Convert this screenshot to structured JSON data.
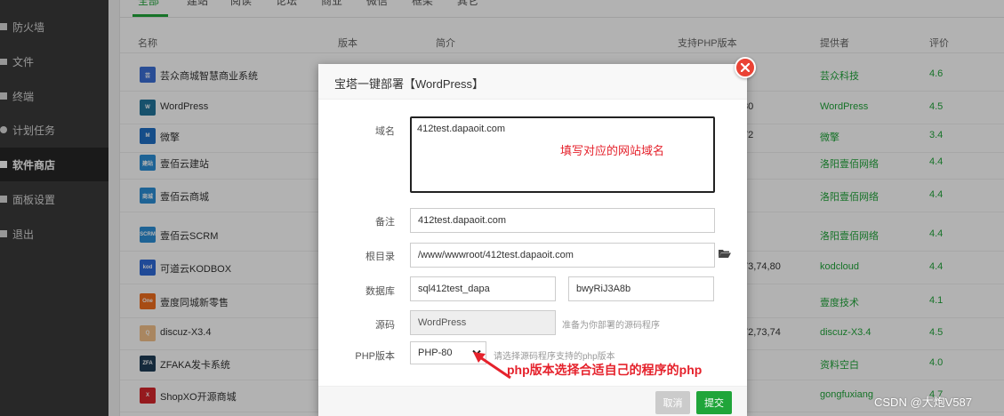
{
  "sidebar": {
    "items": [
      {
        "label": "防火墙",
        "icon": "shield-icon"
      },
      {
        "label": "文件",
        "icon": "folder-icon"
      },
      {
        "label": "终端",
        "icon": "terminal-icon"
      },
      {
        "label": "计划任务",
        "icon": "clock-icon"
      },
      {
        "label": "软件商店",
        "icon": "store-icon"
      },
      {
        "label": "面板设置",
        "icon": "gear-icon"
      },
      {
        "label": "退出",
        "icon": "logout-icon"
      }
    ],
    "active_index": 4
  },
  "tabs": [
    "全部",
    "建站",
    "阅读",
    "论坛",
    "商业",
    "微信",
    "框架",
    "其它"
  ],
  "table": {
    "headers": {
      "name": "名称",
      "version": "版本",
      "intro": "简介",
      "php": "支持PHP版本",
      "provider": "提供者",
      "score": "评价"
    },
    "rows": [
      {
        "name": "芸众商城智慧商业系统",
        "version": "",
        "provider": "芸众科技",
        "score": "4.6",
        "logo_color": "#3b6fd6",
        "logo_text": "芸"
      },
      {
        "name": "WordPress",
        "version": "80",
        "provider": "WordPress",
        "score": "4.5",
        "logo_color": "#21759b",
        "logo_text": "W"
      },
      {
        "name": "微擎",
        "version": "72",
        "provider": "微擎",
        "score": "3.4",
        "logo_color": "#1f6fc5",
        "logo_text": "M"
      },
      {
        "name": "壹佰云建站",
        "version": "",
        "provider": "洛阳壹佰网络",
        "score": "4.4",
        "logo_color": "#2c8fd6",
        "logo_text": "建站"
      },
      {
        "name": "壹佰云商城",
        "version": "",
        "provider": "洛阳壹佰网络",
        "score": "4.4",
        "logo_color": "#2c8fd6",
        "logo_text": "商城"
      },
      {
        "name": "壹佰云SCRM",
        "version": "",
        "provider": "洛阳壹佰网络",
        "score": "4.4",
        "logo_color": "#2c8fd6",
        "logo_text": "SCRM"
      },
      {
        "name": "可道云KODBOX",
        "version": "73,74,80",
        "provider": "kodcloud",
        "score": "4.4",
        "logo_color": "#2f6bd8",
        "logo_text": "kod"
      },
      {
        "name": "壹度同城新零售",
        "version": "",
        "provider": "壹度技术",
        "score": "4.1",
        "logo_color": "#f06d1d",
        "logo_text": "One"
      },
      {
        "name": "discuz-X3.4",
        "version": "72,73,74",
        "provider": "discuz-X3.4",
        "score": "4.5",
        "logo_color": "#f3c08a",
        "logo_text": "Q"
      },
      {
        "name": "ZFAKA发卡系统",
        "version": "",
        "provider": "资料空白",
        "score": "4.0",
        "logo_color": "#1f3d57",
        "logo_text": "ZFA"
      },
      {
        "name": "ShopXO开源商城",
        "version": "",
        "provider": "gongfuxiang",
        "score": "4.7",
        "logo_color": "#d6262c",
        "logo_text": "X"
      }
    ]
  },
  "modal": {
    "title": "宝塔一键部署【WordPress】",
    "domain_label": "域名",
    "domain_value": "412test.dapaoit.com",
    "note_label": "备注",
    "note_value": "412test.dapaoit.com",
    "root_label": "根目录",
    "root_value": "/www/wwwroot/412test.dapaoit.com",
    "db_label": "数据库",
    "db_name": "sql412test_dapa",
    "db_password": "bwyRiJ3A8b",
    "source_label": "源码",
    "source_value": "WordPress",
    "source_hint": "准备为你部署的源码程序",
    "php_label": "PHP版本",
    "php_value": "PHP-80",
    "php_hint": "请选择源码程序支持的php版本",
    "cancel_label": "取消",
    "submit_label": "提交"
  },
  "annotations": {
    "domain_note": "填写对应的网站域名",
    "php_note": "php版本选择合适自己的程序的php"
  },
  "watermark": "CSDN @大炮V587",
  "colors": {
    "accent": "#20a53a",
    "annotation": "#e5222c",
    "close": "#ea4335",
    "sidebar": "#3a3a3a"
  }
}
